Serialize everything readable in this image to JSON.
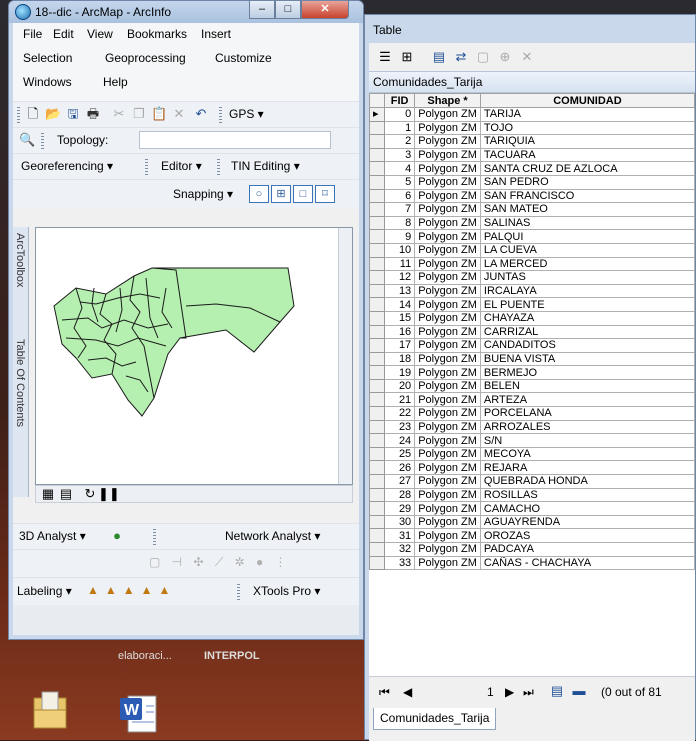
{
  "arcmap": {
    "title": "18--dic - ArcMap - ArcInfo",
    "menus": [
      "File",
      "Edit",
      "View",
      "Bookmarks",
      "Insert",
      "Selection",
      "Geoprocessing",
      "Customize",
      "Windows",
      "Help"
    ],
    "gps_label": "GPS",
    "topology_label": "Topology:",
    "georef_label": "Georeferencing",
    "editor_label": "Editor",
    "tin_label": "TIN Editing",
    "snapping_label": "Snapping",
    "arctoolbox_label": "ArcToolbox",
    "toc_label": "Table Of Contents",
    "analyst3d_label": "3D Analyst",
    "network_label": "Network Analyst",
    "labeling_label": "Labeling",
    "xtools_label": "XTools Pro",
    "map_fill": "#b6f0b0"
  },
  "taskbar": {
    "item1": "elaboraci...",
    "item2": "INTERPOL"
  },
  "table": {
    "window_title": "Table",
    "layer_name": "Comunidades_Tarija",
    "columns": [
      "FID",
      "Shape *",
      "COMUNIDAD"
    ],
    "rows": [
      [
        "0",
        "Polygon ZM",
        "TARIJA"
      ],
      [
        "1",
        "Polygon ZM",
        "TOJO"
      ],
      [
        "2",
        "Polygon ZM",
        "TARIQUIA"
      ],
      [
        "3",
        "Polygon ZM",
        "TACUARA"
      ],
      [
        "4",
        "Polygon ZM",
        "SANTA CRUZ DE AZLOCA"
      ],
      [
        "5",
        "Polygon ZM",
        "SAN PEDRO"
      ],
      [
        "6",
        "Polygon ZM",
        "SAN FRANCISCO"
      ],
      [
        "7",
        "Polygon ZM",
        "SAN MATEO"
      ],
      [
        "8",
        "Polygon ZM",
        "SALINAS"
      ],
      [
        "9",
        "Polygon ZM",
        "PALQUI"
      ],
      [
        "10",
        "Polygon ZM",
        "LA CUEVA"
      ],
      [
        "11",
        "Polygon ZM",
        "LA MERCED"
      ],
      [
        "12",
        "Polygon ZM",
        "JUNTAS"
      ],
      [
        "13",
        "Polygon ZM",
        "IRCALAYA"
      ],
      [
        "14",
        "Polygon ZM",
        "EL PUENTE"
      ],
      [
        "15",
        "Polygon ZM",
        "CHAYAZA"
      ],
      [
        "16",
        "Polygon ZM",
        "CARRIZAL"
      ],
      [
        "17",
        "Polygon ZM",
        "CANDADITOS"
      ],
      [
        "18",
        "Polygon ZM",
        "BUENA VISTA"
      ],
      [
        "19",
        "Polygon ZM",
        "BERMEJO"
      ],
      [
        "20",
        "Polygon ZM",
        "BELEN"
      ],
      [
        "21",
        "Polygon ZM",
        "ARTEZA"
      ],
      [
        "22",
        "Polygon ZM",
        "PORCELANA"
      ],
      [
        "23",
        "Polygon ZM",
        "ARROZALES"
      ],
      [
        "24",
        "Polygon ZM",
        "S/N"
      ],
      [
        "25",
        "Polygon ZM",
        "MECOYA"
      ],
      [
        "26",
        "Polygon ZM",
        "REJARA"
      ],
      [
        "27",
        "Polygon ZM",
        "QUEBRADA HONDA"
      ],
      [
        "28",
        "Polygon ZM",
        "ROSILLAS"
      ],
      [
        "29",
        "Polygon ZM",
        "CAMACHO"
      ],
      [
        "30",
        "Polygon ZM",
        "AGUAYRENDA"
      ],
      [
        "31",
        "Polygon ZM",
        "OROZAS"
      ],
      [
        "32",
        "Polygon ZM",
        "PADCAYA"
      ],
      [
        "33",
        "Polygon ZM",
        "CAÑAS - CHACHAYA"
      ]
    ],
    "nav_record": "1",
    "nav_status": "(0 out of 81",
    "tab_label": "Comunidades_Tarija"
  }
}
